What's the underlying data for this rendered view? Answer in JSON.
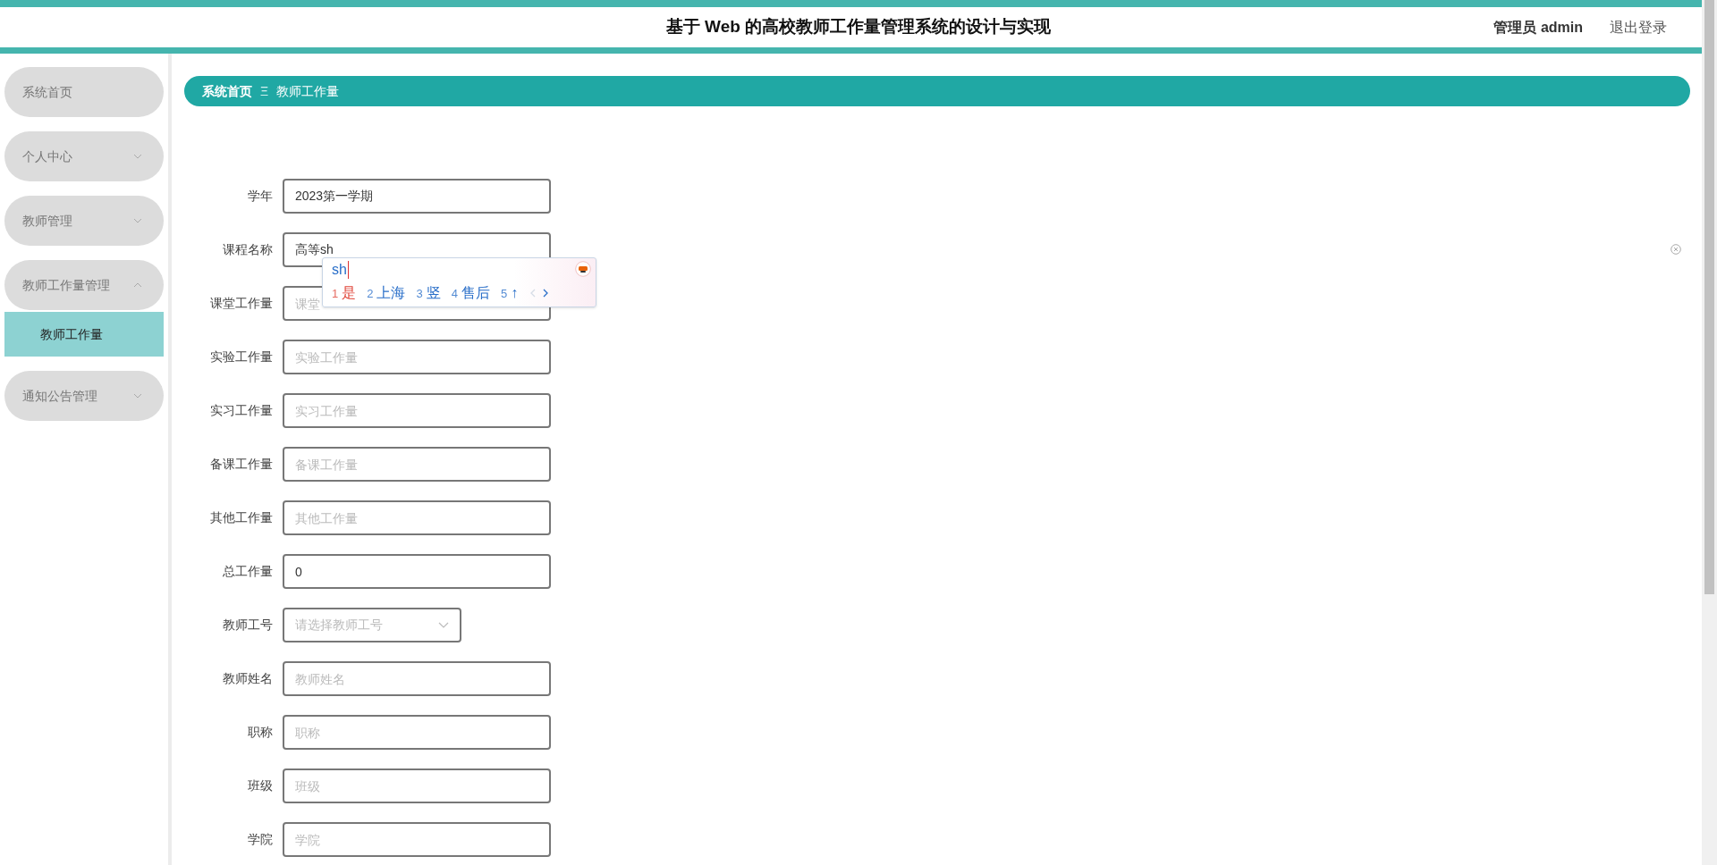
{
  "header": {
    "title": "基于 Web 的高校教师工作量管理系统的设计与实现",
    "user": "管理员 admin",
    "logout": "退出登录"
  },
  "sidebar": {
    "items": [
      {
        "label": "系统首页",
        "kind": "link"
      },
      {
        "label": "个人中心",
        "kind": "menu",
        "expanded": false
      },
      {
        "label": "教师管理",
        "kind": "menu",
        "expanded": false
      },
      {
        "label": "教师工作量管理",
        "kind": "menu",
        "expanded": true,
        "children": [
          {
            "label": "教师工作量",
            "selected": true
          }
        ]
      },
      {
        "label": "通知公告管理",
        "kind": "menu",
        "expanded": false
      }
    ]
  },
  "breadcrumb": {
    "items": [
      "系统首页",
      "教师工作量"
    ],
    "separator": "Ξ"
  },
  "form": {
    "fields": [
      {
        "label": "学年",
        "kind": "input",
        "value": "2023第一学期"
      },
      {
        "label": "课程名称",
        "kind": "input",
        "value": "高等sh"
      },
      {
        "label": "课堂工作量",
        "kind": "input",
        "placeholder": "课堂"
      },
      {
        "label": "实验工作量",
        "kind": "input",
        "placeholder": "实验工作量"
      },
      {
        "label": "实习工作量",
        "kind": "input",
        "placeholder": "实习工作量"
      },
      {
        "label": "备课工作量",
        "kind": "input",
        "placeholder": "备课工作量"
      },
      {
        "label": "其他工作量",
        "kind": "input",
        "placeholder": "其他工作量"
      },
      {
        "label": "总工作量",
        "kind": "input",
        "value": "0"
      },
      {
        "label": "教师工号",
        "kind": "select",
        "placeholder": "请选择教师工号"
      },
      {
        "label": "教师姓名",
        "kind": "input",
        "placeholder": "教师姓名"
      },
      {
        "label": "职称",
        "kind": "input",
        "placeholder": "职称"
      },
      {
        "label": "班级",
        "kind": "input",
        "placeholder": "班级"
      },
      {
        "label": "学院",
        "kind": "input",
        "placeholder": "学院"
      }
    ]
  },
  "ime_popup": {
    "composition": "sh",
    "candidates": [
      {
        "number": "1",
        "text": "是",
        "selected": true
      },
      {
        "number": "2",
        "text": "上海",
        "selected": false
      },
      {
        "number": "3",
        "text": "竖",
        "selected": false
      },
      {
        "number": "4",
        "text": "售后",
        "selected": false
      },
      {
        "number": "5",
        "text": "↑",
        "selected": false
      }
    ],
    "prev_enabled": false,
    "next_enabled": true
  }
}
